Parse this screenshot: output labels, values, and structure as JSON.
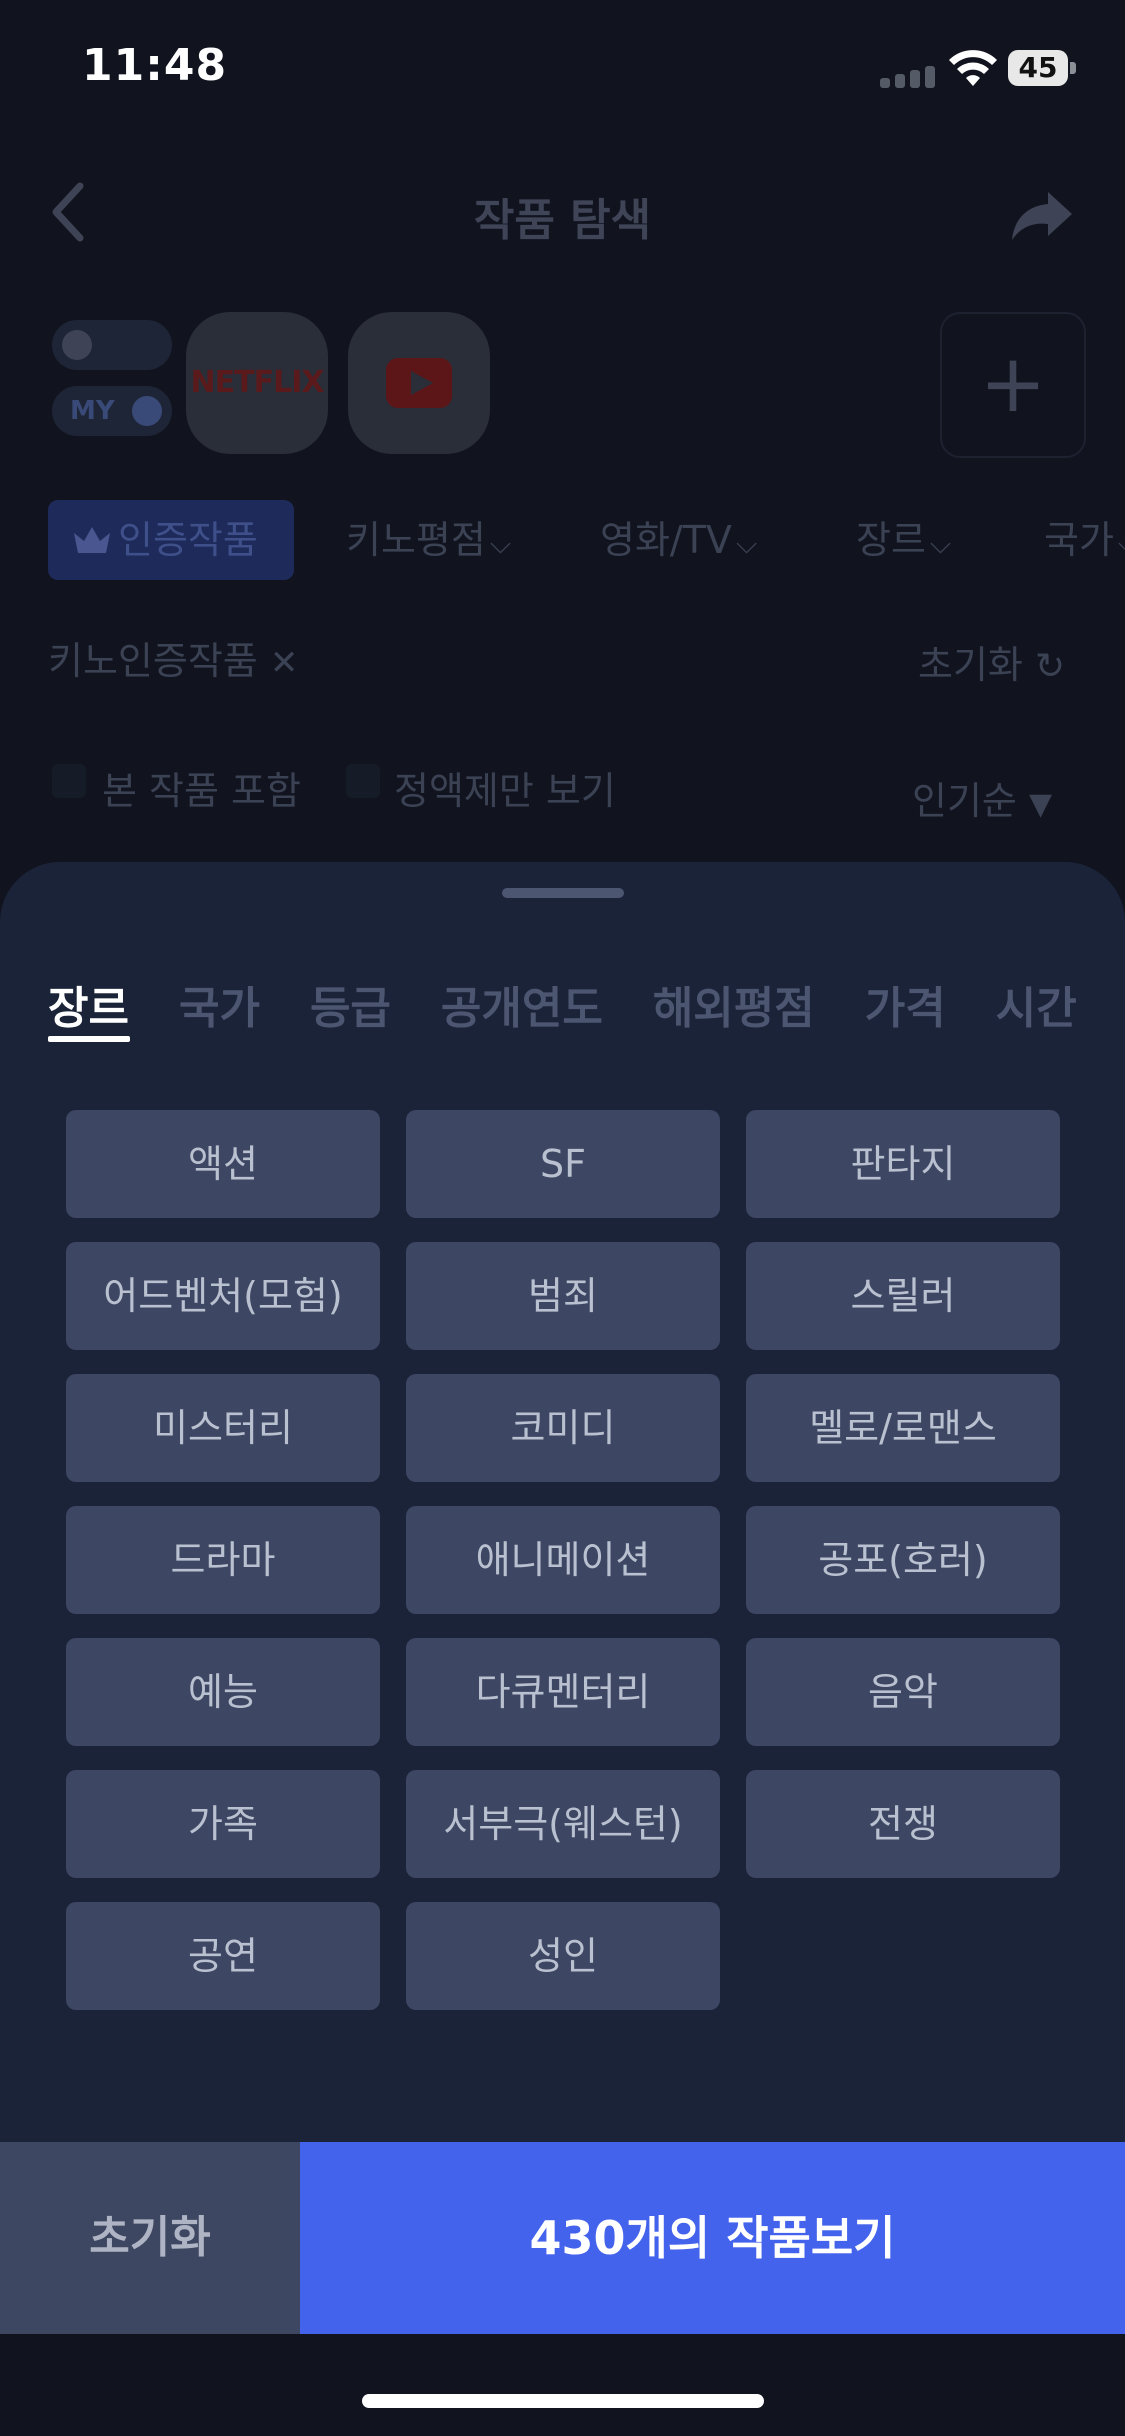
{
  "status_bar": {
    "time": "11:48",
    "battery": "45",
    "icons": [
      "signal-icon",
      "wifi-icon",
      "battery-icon"
    ]
  },
  "header": {
    "title": "작품 탐색",
    "back_icon": "chevron-left-icon",
    "share_icon": "share-icon"
  },
  "services": {
    "toggles": [
      "",
      "MY"
    ],
    "netflix_label": "NETFLIX",
    "youtube_icon": "youtube-icon",
    "add_icon": "plus-icon"
  },
  "filter_chips": [
    {
      "label": "인증작품",
      "icon": "crown-icon",
      "active": true
    },
    {
      "label": "키노평점",
      "dropdown": true
    },
    {
      "label": "영화/TV",
      "dropdown": true
    },
    {
      "label": "장르",
      "dropdown": true
    },
    {
      "label": "국가",
      "dropdown": true
    }
  ],
  "applied_filter": {
    "label": "키노인증작품",
    "remove_icon": "close-icon",
    "reset_label": "초기화",
    "reset_icon": "refresh-icon"
  },
  "options": {
    "include_seen": "본 작품 포함",
    "flat_rate_only": "정액제만 보기",
    "sort": "인기순"
  },
  "sheet": {
    "tabs": [
      "장르",
      "국가",
      "등급",
      "공개연도",
      "해외평점",
      "가격",
      "시간"
    ],
    "active_tab": "장르",
    "genres": [
      "액션",
      "SF",
      "판타지",
      "어드벤처(모험)",
      "범죄",
      "스릴러",
      "미스터리",
      "코미디",
      "멜로/로맨스",
      "드라마",
      "애니메이션",
      "공포(호러)",
      "예능",
      "다큐멘터리",
      "음악",
      "가족",
      "서부극(웨스턴)",
      "전쟁",
      "공연",
      "성인"
    ]
  },
  "footer": {
    "reset_label": "초기화",
    "view_label": "430개의 작품보기"
  },
  "colors": {
    "background": "#11141f",
    "sheet": "#1b2339",
    "genre_button": "#3d4763",
    "primary": "#4463ec",
    "reset_button": "#3e4761"
  }
}
